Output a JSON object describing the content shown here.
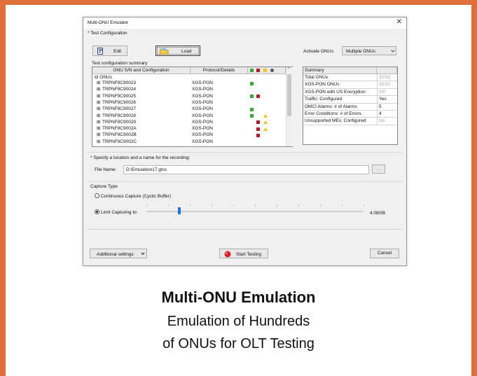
{
  "window": {
    "title": "Multi-ONU Emulator",
    "close_glyph": "✕"
  },
  "test_config": {
    "section_label": "* Test Configuration",
    "edit_label": "Edit",
    "load_label": "Load",
    "activate_label": "Activate ONUs:",
    "activate_value": "Multiple ONUs",
    "summary_label": "Test configuration summary"
  },
  "onu_table": {
    "col_config": "ONU S/N and Configuration",
    "col_protocol": "Protocol/Details",
    "root": "ONUs",
    "rows": [
      {
        "sn": "TRPNF9C90023",
        "protocol": "XGS-PON",
        "green": true,
        "red": false,
        "warn": false
      },
      {
        "sn": "TRPNF9C90024",
        "protocol": "XGS-PON",
        "green": false,
        "red": false,
        "warn": false
      },
      {
        "sn": "TRPNF9C90025",
        "protocol": "XGS-PON",
        "green": true,
        "red": true,
        "warn": false
      },
      {
        "sn": "TRPNF9C90026",
        "protocol": "XGS-PON",
        "green": false,
        "red": false,
        "warn": false
      },
      {
        "sn": "TRPNF9C90027",
        "protocol": "XGS-PON",
        "green": true,
        "red": false,
        "warn": false
      },
      {
        "sn": "TRPNF9C90028",
        "protocol": "XGS-PON",
        "green": true,
        "red": false,
        "warn": true
      },
      {
        "sn": "TRPNF9C90029",
        "protocol": "XGS-PON",
        "green": false,
        "red": true,
        "warn": true
      },
      {
        "sn": "TRPNF9C9002A",
        "protocol": "XGS-PON",
        "green": false,
        "red": true,
        "warn": true
      },
      {
        "sn": "TRPNF9C9002B",
        "protocol": "XGS-PON",
        "green": false,
        "red": true,
        "warn": false
      },
      {
        "sn": "TRPNF9C9002C",
        "protocol": "XGS-PON",
        "green": false,
        "red": false,
        "warn": false
      }
    ]
  },
  "summary": {
    "header": "Summary",
    "rows": [
      {
        "label": "Total ONUs",
        "value": "32/32",
        "muted": true
      },
      {
        "label": "XGS-PON ONUs",
        "value": "32/32",
        "muted": true
      },
      {
        "label": "XGS-PON with US Encryption",
        "value": "0/0",
        "muted": true
      },
      {
        "label": "Traffic: Configured",
        "value": "Yes",
        "muted": false
      },
      {
        "label": "OMCI Alarms: # of Alarms",
        "value": "5",
        "muted": false
      },
      {
        "label": "Error Conditions: # of Errors",
        "value": "4",
        "muted": false
      },
      {
        "label": "Unsupported MEs: Configured",
        "value": "No",
        "muted": true
      }
    ]
  },
  "recording": {
    "section_label": "* Specify a location and a name for the recording:",
    "file_label": "File Name:",
    "file_value": "D:\\Emulation17.gtss",
    "browse_label": "..."
  },
  "capture": {
    "section_label": "Capture Type",
    "continuous_label": "Continuous Capture (Cyclic Buffer)",
    "limit_label": "Limit Capturing to:",
    "limit_value": "4.08GB",
    "slider_fraction": 0.08
  },
  "footer": {
    "additional_label": "Additional settings",
    "start_label": "Start Testing",
    "cancel_label": "Cancel"
  },
  "caption": {
    "title": "Multi-ONU Emulation",
    "line1": "Emulation of Hundreds",
    "line2": "of ONUs for OLT Testing"
  },
  "colors": {
    "border": "#e0703a",
    "green": "#3aa53a",
    "red": "#b01e2e",
    "warn": "#f0c419",
    "slider": "#1f6fd1",
    "record": "#d32020"
  }
}
